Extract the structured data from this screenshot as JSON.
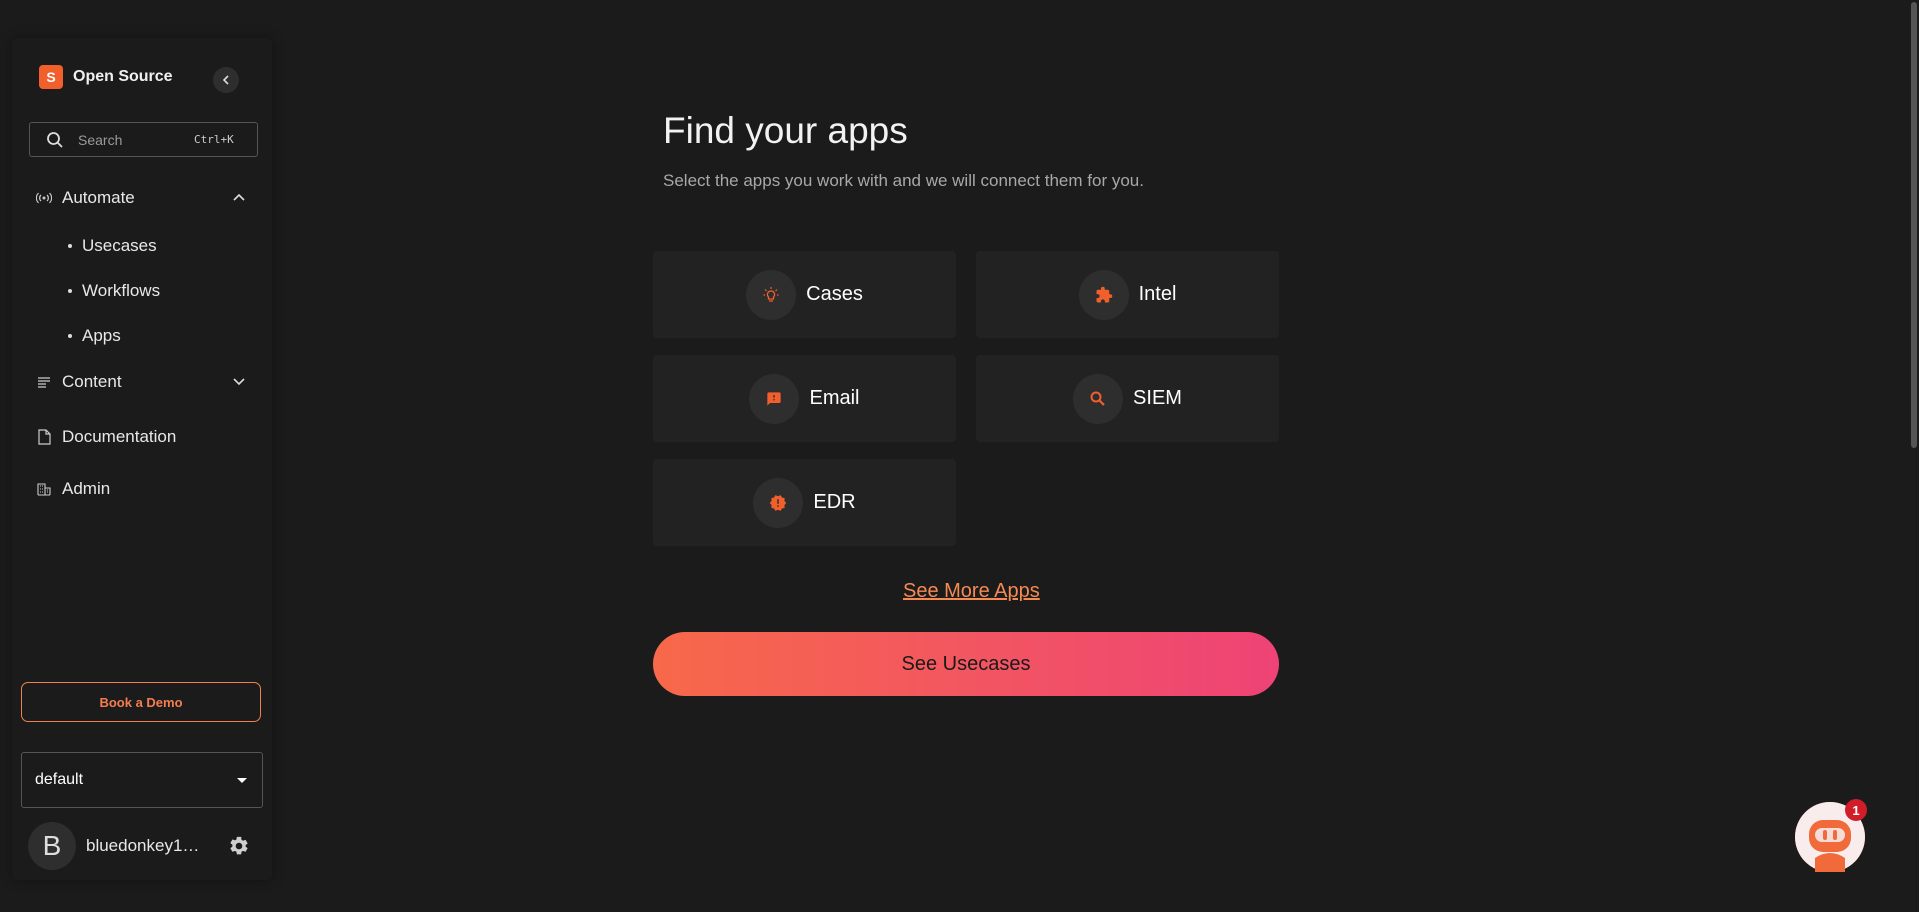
{
  "sidebar": {
    "brand": "Open Source",
    "brand_logo_glyph": "S",
    "search": {
      "placeholder": "Search",
      "shortcut": "Ctrl+K"
    },
    "nav": {
      "automate": "Automate",
      "automate_children": [
        "Usecases",
        "Workflows",
        "Apps"
      ],
      "content": "Content",
      "documentation": "Documentation",
      "admin": "Admin"
    },
    "book_demo": "Book a Demo",
    "org_select": "default",
    "user": {
      "initial": "B",
      "name": "bluedonkey1…"
    }
  },
  "main": {
    "title": "Find your apps",
    "subtitle": "Select the apps you work with and we will connect them for you.",
    "apps": [
      {
        "label": "Cases",
        "icon": "lightbulb-icon"
      },
      {
        "label": "Intel",
        "icon": "puzzle-icon"
      },
      {
        "label": "Email",
        "icon": "chat-alert-icon"
      },
      {
        "label": "SIEM",
        "icon": "search-icon"
      },
      {
        "label": "EDR",
        "icon": "shield-alert-icon"
      }
    ],
    "see_more": "See More Apps",
    "see_usecases": "See Usecases"
  },
  "chat": {
    "badge_count": "1"
  },
  "colors": {
    "accent": "#f15f2c",
    "accent_light": "#f47e4f",
    "gradient_start": "#f7694a",
    "gradient_end": "#ee4376",
    "background": "#1b1b1b",
    "card": "#222222"
  }
}
